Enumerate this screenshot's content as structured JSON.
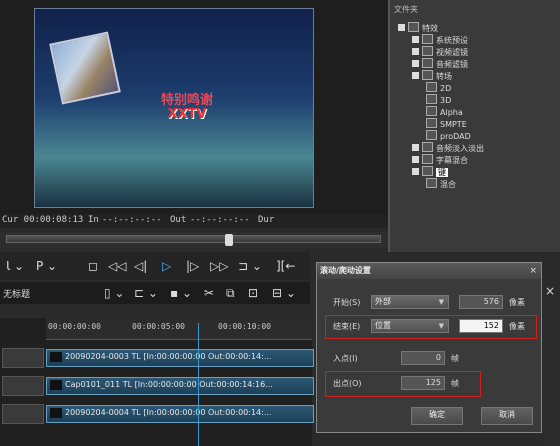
{
  "preview": {
    "title_line1": "特别鸣谢",
    "title_line2": "XXTV",
    "timecode_cur": "Cur 00:00:08:13",
    "in_label": "In",
    "in_value": "--:--:--:--",
    "out_label": "Out",
    "out_value": "--:--:--:--",
    "dur_label": "Dur"
  },
  "library": {
    "header": "文件夹",
    "items": [
      {
        "label": "特效",
        "indent": 0
      },
      {
        "label": "系统预设",
        "indent": 1
      },
      {
        "label": "视频滤镜",
        "indent": 1
      },
      {
        "label": "音频滤镜",
        "indent": 1
      },
      {
        "label": "转场",
        "indent": 1
      },
      {
        "label": "2D",
        "indent": 2
      },
      {
        "label": "3D",
        "indent": 2
      },
      {
        "label": "Alpha",
        "indent": 2
      },
      {
        "label": "SMPTE",
        "indent": 2
      },
      {
        "label": "proDAD",
        "indent": 2
      },
      {
        "label": "音频淡入淡出",
        "indent": 1
      },
      {
        "label": "字幕混合",
        "indent": 1
      },
      {
        "label": "键",
        "indent": 1
      },
      {
        "label": "混合",
        "indent": 2
      }
    ]
  },
  "toolbar": {
    "untitled": "无标题"
  },
  "timeline": {
    "ruler": [
      "00:00:00:00",
      "00:00:05:00",
      "00:00:10:00"
    ],
    "clips": [
      "20090204-0003  TL [In:00:00:00:00 Out:00:00:14:...",
      "Cap0101_011  TL [In:00:00:00:00 Out:00:00:14:16...",
      "20090204-0004  TL [In:00:00:00:00 Out:00:00:14:..."
    ]
  },
  "dialog": {
    "title": "滚动/爬动设置",
    "close": "×",
    "start_label": "开始(S)",
    "start_select": "外部",
    "start_value": "576",
    "start_unit": "像素",
    "end_label": "结束(E)",
    "end_select": "位置",
    "end_value": "152",
    "end_unit": "像素",
    "in_label": "入点(I)",
    "in_value": "0",
    "in_unit": "帧",
    "out_label": "出点(O)",
    "out_value": "125",
    "out_unit": "帧",
    "ok": "确定",
    "cancel": "取消"
  }
}
